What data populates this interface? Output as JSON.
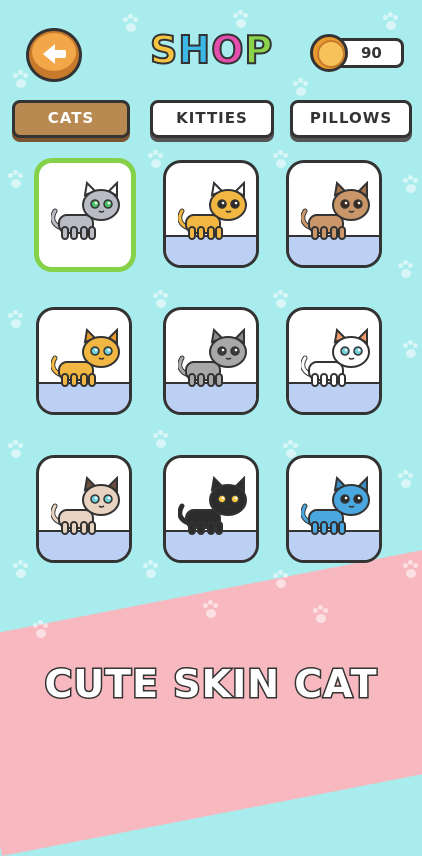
{
  "header": {
    "title_letters": [
      "S",
      "H",
      "O",
      "P"
    ],
    "title_colors": [
      "#f5c542",
      "#3bb8e8",
      "#e44fae",
      "#8ad34b"
    ],
    "coins": "90"
  },
  "tabs": [
    {
      "label": "CATS",
      "active": true
    },
    {
      "label": "KITTIES",
      "active": false
    },
    {
      "label": "PILLOWS",
      "active": false
    }
  ],
  "cards": [
    {
      "body": "#b9bcc4",
      "accent": "#ffffff",
      "eye": "#4cc26a",
      "selected": true
    },
    {
      "body": "#f1b742",
      "accent": "#ffffff",
      "eye": "#2b2b2b",
      "selected": false
    },
    {
      "body": "#c9966a",
      "accent": "#a4744b",
      "eye": "#3a2a1f",
      "selected": false
    },
    {
      "body": "#f1b742",
      "accent": "#e99b2c",
      "eye": "#6ed0d8",
      "selected": false
    },
    {
      "body": "#a8a8ab",
      "accent": "#8a8a8c",
      "eye": "#3a3a3a",
      "selected": false
    },
    {
      "body": "#ffffff",
      "accent": "#ee9d6b",
      "eye": "#6ed0d8",
      "selected": false
    },
    {
      "body": "#e8d3c1",
      "accent": "#6b4e3d",
      "eye": "#6ed0d8",
      "selected": false
    },
    {
      "body": "#2c2c2c",
      "accent": "#2c2c2c",
      "eye": "#f5c542",
      "selected": false
    },
    {
      "body": "#4aa7e0",
      "accent": "#3b8fc6",
      "eye": "#2b2b2b",
      "selected": false
    }
  ],
  "caption": "CUTE SKIN CAT"
}
